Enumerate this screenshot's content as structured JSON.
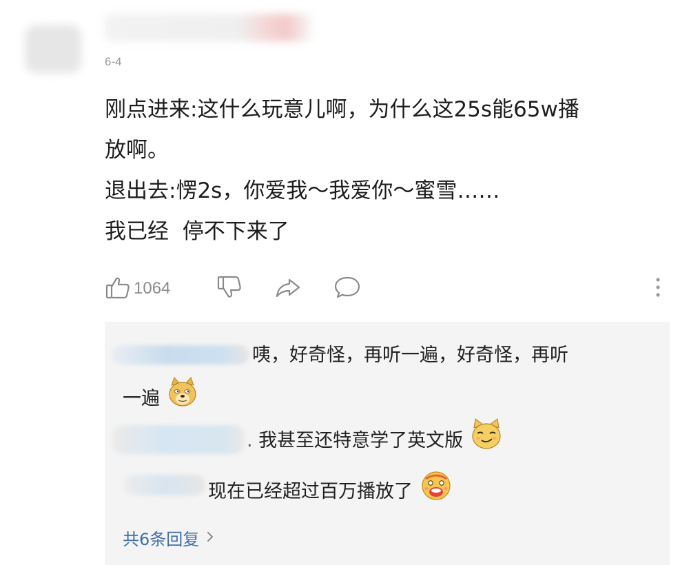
{
  "header": {
    "date": "6-4"
  },
  "comment": {
    "lines": [
      "刚点进来:这什么玩意儿啊，为什么这25s能65w播",
      "放啊。",
      "退出去:愣2s，你爱我～我爱你～蜜雪……",
      "我已经  停不下来了"
    ]
  },
  "actions": {
    "like_count": "1064",
    "icons": [
      "thumbs-up-icon",
      "thumbs-down-icon",
      "share-icon",
      "comment-icon",
      "more-vertical-icon"
    ]
  },
  "replies": {
    "items": [
      {
        "text_line1": "咦，好奇怪，再听一遍，好奇怪，再听",
        "text_line2": "一遍",
        "emoji": "doge-emoji"
      },
      {
        "text": "我甚至还特意学了英文版",
        "emoji": "smirk-cat-emoji"
      },
      {
        "text": "现在已经超过百万播放了",
        "emoji": "mind-blown-emoji"
      }
    ],
    "more_label": "共6条回复"
  },
  "colors": {
    "link_blue": "#3f6ea8",
    "meta_gray": "#9a9a9a",
    "panel_bg": "#f4f4f4"
  }
}
